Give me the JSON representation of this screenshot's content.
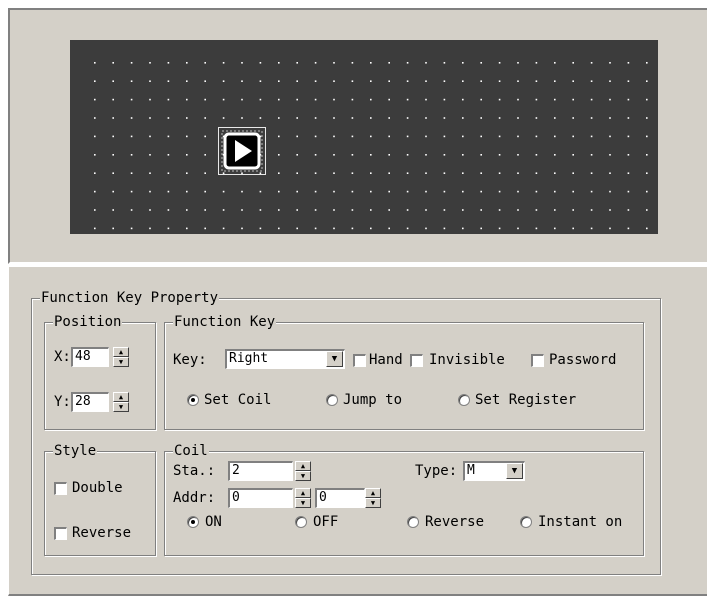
{
  "property_panel": {
    "title": "Function Key Property",
    "position": {
      "title": "Position",
      "x_label": "X:",
      "x_value": "48",
      "y_label": "Y:",
      "y_value": "28"
    },
    "function_key": {
      "title": "Function Key",
      "key_label": "Key:",
      "key_value": "Right",
      "hand_label": "Hand",
      "invisible_label": "Invisible",
      "password_label": "Password",
      "radio_set_coil": "Set Coil",
      "radio_jump_to": "Jump to",
      "radio_set_register": "Set Register",
      "selected_mode": "Set Coil"
    },
    "style": {
      "title": "Style",
      "double_label": "Double",
      "reverse_label": "Reverse"
    },
    "coil": {
      "title": "Coil",
      "sta_label": "Sta.:",
      "sta_value": "2",
      "type_label": "Type:",
      "type_value": "M",
      "addr_label": "Addr:",
      "addr_value_1": "0",
      "addr_value_2": "0",
      "radio_on": "ON",
      "radio_off": "OFF",
      "radio_reverse": "Reverse",
      "radio_instant_on": "Instant on",
      "selected_action": "ON"
    }
  },
  "colors": {
    "panel_bg": "#d4d0c8",
    "screen_bg": "#3c3c3c",
    "grid_dot": "#ffffff"
  },
  "icons": {
    "function_key_icon": "play-icon",
    "spin_up": "triangle-up-icon",
    "spin_down": "triangle-down-icon",
    "dropdown": "chevron-down-icon"
  }
}
